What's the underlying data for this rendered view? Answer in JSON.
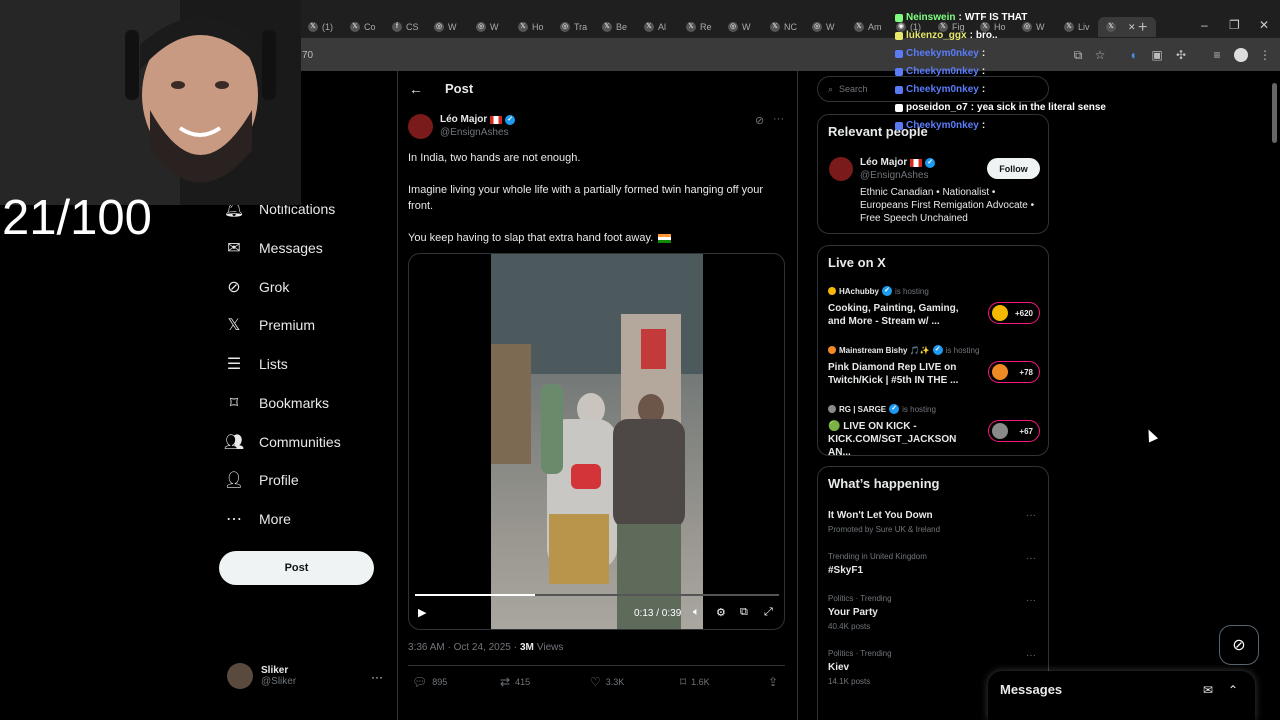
{
  "browser": {
    "tabs": [
      {
        "icon": "x-logo",
        "label": "(1)"
      },
      {
        "icon": "x-logo",
        "label": "Co"
      },
      {
        "icon": "facebook-logo",
        "label": "CS"
      },
      {
        "icon": "web-icon",
        "label": "W"
      },
      {
        "icon": "web-icon",
        "label": "W"
      },
      {
        "icon": "x-logo",
        "label": "Ho"
      },
      {
        "icon": "web-icon",
        "label": "Tra"
      },
      {
        "icon": "x-logo",
        "label": "Be"
      },
      {
        "icon": "x-logo",
        "label": "Al"
      },
      {
        "icon": "x-logo",
        "label": "Re"
      },
      {
        "icon": "web-icon",
        "label": "W"
      },
      {
        "icon": "x-logo",
        "label": "NC"
      },
      {
        "icon": "web-icon",
        "label": "W"
      },
      {
        "icon": "x-logo",
        "label": "Am"
      },
      {
        "icon": "instagram-logo",
        "label": "(1)"
      },
      {
        "icon": "x-logo",
        "label": "Fig"
      },
      {
        "icon": "x-logo",
        "label": "Ho"
      },
      {
        "icon": "web-icon",
        "label": "W"
      },
      {
        "icon": "x-logo",
        "label": "Liv"
      }
    ],
    "active_tab_icon": "x-logo",
    "address_fragment": "70"
  },
  "overlay": {
    "score": "21/100",
    "chat": [
      {
        "user": "Neinswein",
        "message": "WTF IS THAT",
        "color": "#7fff7f"
      },
      {
        "user": "lukenzo_ggx",
        "message": "bro..",
        "color": "#e8e86b"
      },
      {
        "user": "Cheekym0nkey",
        "message": "",
        "color": "#5b7cfa"
      },
      {
        "user": "Cheekym0nkey",
        "message": "",
        "color": "#5b7cfa"
      },
      {
        "user": "Cheekym0nkey",
        "message": "",
        "color": "#5b7cfa"
      },
      {
        "user": "poseidon_o7",
        "message": "yea sick in the literal sense",
        "color": "#ffffff"
      },
      {
        "user": "Cheekym0nkey",
        "message": "",
        "color": "#5b7cfa"
      }
    ]
  },
  "nav": {
    "items": [
      {
        "label": "Notifications",
        "icon": "bell-icon"
      },
      {
        "label": "Messages",
        "icon": "envelope-icon"
      },
      {
        "label": "Grok",
        "icon": "grok-icon"
      },
      {
        "label": "Premium",
        "icon": "x-icon"
      },
      {
        "label": "Lists",
        "icon": "list-icon"
      },
      {
        "label": "Bookmarks",
        "icon": "bookmark-icon"
      },
      {
        "label": "Communities",
        "icon": "people-icon"
      },
      {
        "label": "Profile",
        "icon": "person-icon"
      },
      {
        "label": "More",
        "icon": "more-circle-icon"
      }
    ],
    "post_button": "Post",
    "account": {
      "name": "Sliker",
      "handle": "@Sliker"
    }
  },
  "post": {
    "header_title": "Post",
    "author_name": "Léo Major",
    "author_handle": "@EnsignAshes",
    "paragraphs": [
      "In India, two hands are not enough.",
      "Imagine living your whole life with a partially formed twin hanging off your front.",
      "You keep having to slap that extra hand foot away."
    ],
    "video": {
      "time": "0:13 / 0:39",
      "progress": 0.33
    },
    "timestamp": "3:36 AM · Oct 24, 2025 ·",
    "views_count": "3M",
    "views_label": "Views",
    "stats": {
      "replies": "895",
      "reposts": "415",
      "likes": "3.3K",
      "bookmarks": "1.6K"
    }
  },
  "sidebar": {
    "search_placeholder": "Search",
    "relevant": {
      "title": "Relevant people",
      "name": "Léo Major",
      "handle": "@EnsignAshes",
      "bio": "Ethnic Canadian • Nationalist • Europeans First Remigation Advocate • Free Speech Unchained",
      "follow": "Follow"
    },
    "live": {
      "title": "Live on X",
      "items": [
        {
          "host": "HAchubby",
          "hosting": "is hosting",
          "title": "Cooking, Painting, Gaming, and More - Stream w/ ...",
          "count": "+620",
          "color": "#f5b700"
        },
        {
          "host": "Mainstream Bishy 🎵✨",
          "hosting": "is hosting",
          "title": "Pink Diamond Rep LIVE on Twitch/Kick | #5th IN THE ...",
          "count": "+78",
          "color": "#f08a24"
        },
        {
          "host": "RG | SARGE",
          "hosting": "is hosting",
          "title": "🟢 LIVE ON KICK - KICK.COM/SGT_JACKSON AN...",
          "count": "+67",
          "color": "#8a8a8a"
        }
      ]
    },
    "happening": {
      "title": "What’s happening",
      "items": [
        {
          "context": "",
          "name": "It Won't Let You Down",
          "meta": "Promoted by Sure UK & Ireland"
        },
        {
          "context": "Trending in United Kingdom",
          "name": "#SkyF1",
          "meta": ""
        },
        {
          "context": "Politics · Trending",
          "name": "Your Party",
          "meta": "40.4K posts"
        },
        {
          "context": "Politics · Trending",
          "name": "Kiev",
          "meta": "14.1K posts"
        }
      ]
    }
  },
  "messages_drawer": {
    "title": "Messages"
  }
}
